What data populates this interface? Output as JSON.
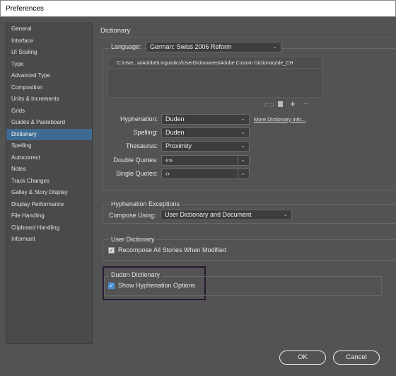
{
  "window": {
    "title": "Preferences"
  },
  "sidebar": {
    "items": [
      "General",
      "Interface",
      "UI Scaling",
      "Type",
      "Advanced Type",
      "Composition",
      "Units & Increments",
      "Grids",
      "Guides & Pasteboard",
      "Dictionary",
      "Spelling",
      "Autocorrect",
      "Notes",
      "Track Changes",
      "Galley & Story Display",
      "Display Performance",
      "File Handling",
      "Clipboard Handling",
      "Informant"
    ],
    "selected": "Dictionary"
  },
  "main": {
    "title": "Dictionary",
    "language": {
      "label": "Language:",
      "value": "German: Swiss 2006 Reform"
    },
    "dictionary_list": [
      "C:\\User...w\\Adobe\\Linguistics\\UserDictionaries\\Adobe Custom Dictionary\\de_CH"
    ],
    "list_icons": [
      "link-icon",
      "new-page-icon",
      "plus-icon",
      "minus-icon"
    ],
    "hyphenation": {
      "label": "Hyphenation:",
      "value": "Duden"
    },
    "more_info": "More Dictionary Info...",
    "spelling": {
      "label": "Spelling:",
      "value": "Duden"
    },
    "thesaurus": {
      "label": "Thesaurus:",
      "value": "Proximity"
    },
    "double_quotes": {
      "label": "Double Quotes:",
      "value": "«»"
    },
    "single_quotes": {
      "label": "Single Quotes:",
      "value": "‹›"
    },
    "hyph_exceptions": {
      "title": "Hyphenation Exceptions",
      "compose_label": "Compose Using:",
      "compose_value": "User Dictionary and Document"
    },
    "user_dictionary": {
      "title": "User Dictionary",
      "recompose_label": "Recompose All Stories When Modified",
      "recompose_checked": true
    },
    "duden": {
      "title": "Duden Dictionary",
      "show_label": "Show Hyphenation Options",
      "show_checked": true
    }
  },
  "buttons": {
    "ok": "OK",
    "cancel": "Cancel"
  },
  "colors": {
    "selection": "#3f6b93",
    "highlight_border": "#2a1a33",
    "checkbox_blue": "#4a90d9"
  }
}
